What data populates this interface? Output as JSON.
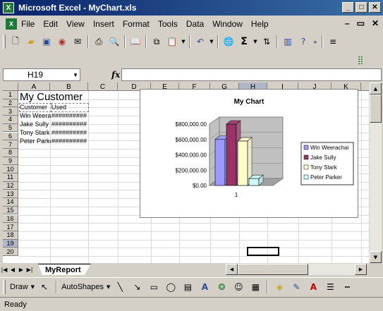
{
  "window": {
    "title": "Microsoft Excel - MyChart.xls"
  },
  "menu": [
    "File",
    "Edit",
    "View",
    "Insert",
    "Format",
    "Tools",
    "Data",
    "Window",
    "Help"
  ],
  "formula_bar": {
    "name_box": "H19",
    "fx": "fx",
    "formula": ""
  },
  "columns": [
    "A",
    "B",
    "C",
    "D",
    "E",
    "F",
    "G",
    "H",
    "I",
    "J",
    "K"
  ],
  "selected_column": "H",
  "rows": [
    "1",
    "2",
    "3",
    "4",
    "5",
    "6",
    "7",
    "8",
    "9",
    "10",
    "11",
    "12",
    "13",
    "14",
    "15",
    "16",
    "17",
    "18",
    "19",
    "20"
  ],
  "selected_row": "19",
  "sheet": {
    "title": "My Customer",
    "header_customer": "Customer",
    "header_used": "Used",
    "customers": [
      "Win Weerachai",
      "Jake Sully",
      "Tony Stark",
      "Peter Parker"
    ],
    "used_display": "##########"
  },
  "sheet_tab": "MyReport",
  "chart_data": {
    "type": "bar",
    "title": "My Chart",
    "categories": [
      "1"
    ],
    "yticks": [
      "$0.00",
      "$200,000.00",
      "$400,000.00",
      "$600,000.00",
      "$800,000.00"
    ],
    "ylim": [
      0,
      800000
    ],
    "series": [
      {
        "name": "Win Weerachai",
        "values": [
          600000
        ],
        "color": "#9999ff"
      },
      {
        "name": "Jake Sully",
        "values": [
          800000
        ],
        "color": "#993366"
      },
      {
        "name": "Tony Stark",
        "values": [
          580000
        ],
        "color": "#ffffcc"
      },
      {
        "name": "Peter Parker",
        "values": [
          90000
        ],
        "color": "#ccffff"
      }
    ],
    "legend": "right"
  },
  "drawing_toolbar": {
    "draw_label": "Draw",
    "autoshapes_label": "AutoShapes"
  },
  "status": {
    "text": "Ready"
  },
  "colors": {
    "titlebar": "#0a246a",
    "grid_selection": "#b0b8c8"
  },
  "icons": [
    "excel-icon",
    "new-icon",
    "open-icon",
    "save-icon",
    "print-icon",
    "undo-icon",
    "sum-icon",
    "sort-icon",
    "chart-wizard-icon",
    "help-icon"
  ]
}
